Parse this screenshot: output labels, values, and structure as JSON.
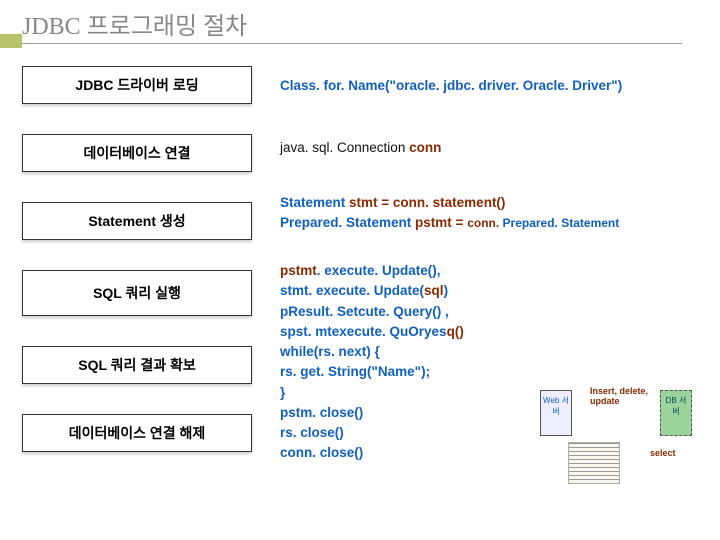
{
  "title": "JDBC 프로그래밍 절차",
  "steps": [
    "JDBC 드라이버 로딩",
    "데이터베이스 연결",
    "Statement 생성",
    "SQL 쿼리 실행",
    "SQL 쿼리 결과 확보",
    "데이터베이스 연결 해제"
  ],
  "code": {
    "r1": "Class. for. Name(\"oracle. jdbc. driver. Oracle. Driver\")",
    "r2a": "java. sql. Connection ",
    "r2b": "conn",
    "r3a": "Statement  ",
    "r3b": "stmt = conn. statement()",
    "r3c": "Prepared. Statement ",
    "r3d": "pstmt = ",
    "r3e": "conn. ",
    "r3f": "Prepared. Statement",
    "r4l1a": "pstmt",
    "r4l1b": ". execute. Update(),",
    "r4l2a": "stmt. execute. Update(",
    "r4l2b": "sql",
    "r4l2c": ")",
    "r4l3": "pResult. Setcute. Query() ,",
    "r4l4a": "spst. mtexecute. QuOryes",
    "r4l4b": "q()",
    "r4l5": " while(rs. next) {",
    "r4l6": " rs. get. String(\"Name\");",
    "r4l7": " }",
    "r4l8": " pstm. close()",
    "r4l9": " rs. close()",
    "r4l10": " conn. close()"
  },
  "dia": {
    "web": "Web\n서버",
    "db": "DB\n서\n버",
    "ins": "Insert,\ndelete,\nupdate",
    "sel": "select"
  }
}
